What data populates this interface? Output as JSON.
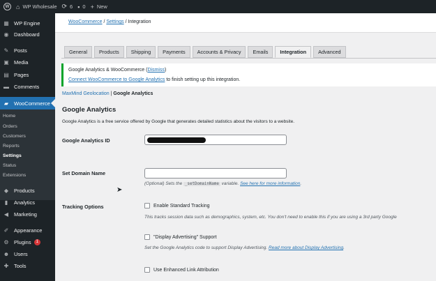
{
  "adminbar": {
    "site_name": "WP Wholesale",
    "updates_count": "6",
    "comments_count": "0",
    "new_label": "New"
  },
  "sidebar": {
    "items": [
      {
        "label": "WP Engine",
        "icon": "wp-engine-icon"
      },
      {
        "label": "Dashboard",
        "icon": "dashboard-icon"
      },
      {
        "label": "Posts",
        "icon": "pin-icon"
      },
      {
        "label": "Media",
        "icon": "media-icon"
      },
      {
        "label": "Pages",
        "icon": "pages-icon"
      },
      {
        "label": "Comments",
        "icon": "comment-icon"
      },
      {
        "label": "WooCommerce",
        "icon": "woo-icon"
      }
    ],
    "woo_submenu": [
      "Home",
      "Orders",
      "Customers",
      "Reports",
      "Settings",
      "Status",
      "Extensions"
    ],
    "lower_items": [
      {
        "label": "Products",
        "icon": "products-icon"
      },
      {
        "label": "Analytics",
        "icon": "analytics-icon"
      },
      {
        "label": "Marketing",
        "icon": "marketing-icon"
      },
      {
        "label": "Appearance",
        "icon": "appearance-icon"
      },
      {
        "label": "Plugins",
        "icon": "plugins-icon",
        "badge": "1"
      },
      {
        "label": "Users",
        "icon": "users-icon"
      },
      {
        "label": "Tools",
        "icon": "tools-icon"
      }
    ]
  },
  "breadcrumb": {
    "woocommerce": "WooCommerce",
    "sep": " / ",
    "settings": "Settings",
    "current": "Integration"
  },
  "tabs": [
    "General",
    "Products",
    "Shipping",
    "Payments",
    "Accounts & Privacy",
    "Emails",
    "Integration",
    "Advanced"
  ],
  "active_tab": "Integration",
  "notice": {
    "title": "Google Analytics & WooCommerce",
    "dismiss": "Dismiss",
    "link": "Connect WooCommerce to Google Analytics",
    "suffix": " to finish setting up this integration."
  },
  "subsub": {
    "maxmind": "MaxMind Geolocation",
    "separator": " | ",
    "current": "Google Analytics"
  },
  "section": {
    "title": "Google Analytics",
    "description": "Google Analytics is a free service offered by Google that generates detailed statistics about the visitors to a website."
  },
  "fields": {
    "ga_id_label": "Google Analytics ID",
    "domain_label": "Set Domain Name",
    "domain_hint_prefix": "(Optional) Sets the ",
    "domain_hint_code": "_setDomainName",
    "domain_hint_mid": " variable. ",
    "domain_hint_link": "See here for more information",
    "domain_hint_end": ".",
    "tracking_label": "Tracking Options",
    "standard_tracking": "Enable Standard Tracking",
    "standard_hint": "This tracks session data such as demographics, system, etc. You don't need to enable this if you are using a 3rd party Google",
    "display_adv": "\"Display Advertising\" Support",
    "display_hint_prefix": "Set the Google Analytics code to support Display Advertising. ",
    "display_hint_link": "Read more about Display Advertising",
    "display_hint_end": ".",
    "enhanced_link": "Use Enhanced Link Attribution"
  }
}
